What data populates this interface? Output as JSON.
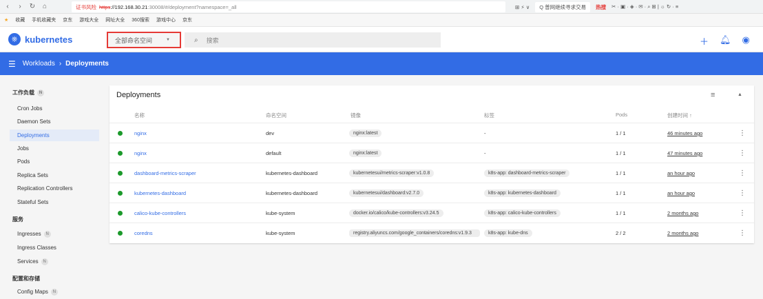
{
  "browser": {
    "nav": {
      "back": "‹",
      "forward": "›",
      "reload": "↻",
      "home": "⌂"
    },
    "security_warning": "证书风险",
    "url_scheme": "https",
    "url_host": "://192.168.30.21",
    "url_rest": ":30008/#/deployment?namespace=_all",
    "right_icons": "⊞ ⚡ ∨",
    "search_hint": "Q 普网继续寻求交易",
    "hot_label": "热搜",
    "right_tools": "✂ · ▣ · ◈ · ✉ · ⌕ ⊞ | ☼ ↻ · ≡"
  },
  "bookmarks": [
    "收藏",
    "手机收藏夹",
    "京东",
    "游戏大全",
    "网址大全",
    "360搜索",
    "游戏中心",
    "京东"
  ],
  "header": {
    "brand": "kubernetes",
    "namespace": "全部命名空间",
    "search_placeholder": "搜索"
  },
  "toolbar": {
    "section": "Workloads",
    "page": "Deployments"
  },
  "sidebar": {
    "workloads_title": "工作负载",
    "badge": "N",
    "workload_items": [
      "Cron Jobs",
      "Daemon Sets",
      "Deployments",
      "Jobs",
      "Pods",
      "Replica Sets",
      "Replication Controllers",
      "Stateful Sets"
    ],
    "active_item": "Deployments",
    "services_title": "服务",
    "service_items": [
      "Ingresses",
      "Ingress Classes",
      "Services"
    ],
    "config_title": "配置和存储",
    "config_items": [
      "Config Maps"
    ]
  },
  "card": {
    "title": "Deployments",
    "columns": {
      "name": "名称",
      "namespace": "命名空间",
      "image": "镜像",
      "labels": "标签",
      "pods": "Pods",
      "created": "创建时间 ↑"
    },
    "rows": [
      {
        "name": "nginx",
        "namespace": "dev",
        "image": "nginx:latest",
        "labels": "-",
        "pods": "1 / 1",
        "created": "46 minutes ago"
      },
      {
        "name": "nginx",
        "namespace": "default",
        "image": "nginx:latest",
        "labels": "-",
        "pods": "1 / 1",
        "created": "47 minutes ago"
      },
      {
        "name": "dashboard-metrics-scraper",
        "namespace": "kubernetes-dashboard",
        "image": "kubernetesui/metrics-scraper:v1.0.8",
        "labels": "k8s-app: dashboard-metrics-scraper",
        "pods": "1 / 1",
        "created": "an hour ago"
      },
      {
        "name": "kubernetes-dashboard",
        "namespace": "kubernetes-dashboard",
        "image": "kubernetesui/dashboard:v2.7.0",
        "labels": "k8s-app: kubernetes-dashboard",
        "pods": "1 / 1",
        "created": "an hour ago"
      },
      {
        "name": "calico-kube-controllers",
        "namespace": "kube-system",
        "image": "docker.io/calico/kube-controllers:v3.24.5",
        "labels": "k8s-app: calico-kube-controllers",
        "pods": "1 / 1",
        "created": "2 months ago"
      },
      {
        "name": "coredns",
        "namespace": "kube-system",
        "image": "registry.aliyuncs.com/google_containers/coredns:v1.9.3",
        "labels": "k8s-app: kube-dns",
        "pods": "2 / 2",
        "created": "2 months ago"
      }
    ]
  },
  "colors": {
    "brand": "#326ce5",
    "status_ok": "#1c9a2b",
    "highlight_border": "#e53935"
  },
  "icons": {
    "add": "add-icon",
    "bell": "notification-bell-icon",
    "account": "account-icon",
    "menu": "menu-icon",
    "filter": "filter-icon",
    "collapse": "chevron-up-icon",
    "kebab": "more-vert-icon"
  }
}
